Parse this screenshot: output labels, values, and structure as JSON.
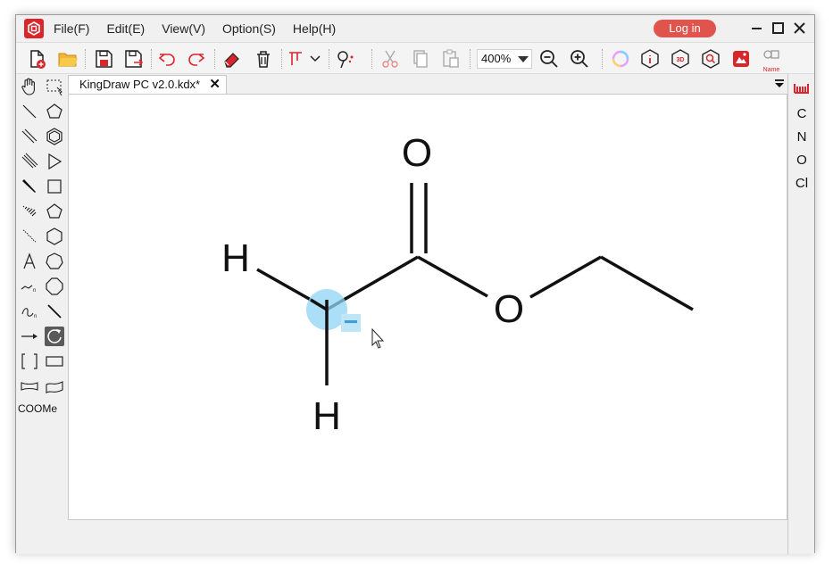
{
  "app": {
    "menu": [
      "File(F)",
      "Edit(E)",
      "View(V)",
      "Option(S)",
      "Help(H)"
    ],
    "login_label": "Log in",
    "brand_color": "#d9262c",
    "login_color": "#e0544e"
  },
  "toolbar": {
    "zoom_value": "400%",
    "name_label": "Name",
    "buttons": [
      "new-file-icon",
      "open-folder-icon",
      "save-icon",
      "save-as-icon",
      "undo-icon",
      "redo-icon",
      "eraser-icon",
      "delete-icon",
      "align-icon",
      "clean-structure-icon",
      "cut-icon",
      "copy-icon",
      "paste-icon",
      "zoom-out-icon",
      "zoom-in-icon",
      "color-ring-icon",
      "info-icon",
      "3d-view-icon",
      "search-structure-icon",
      "image-recognize-icon",
      "name-to-structure-icon"
    ]
  },
  "tabs": [
    {
      "label": "KingDraw PC v2.0.kdx*"
    }
  ],
  "left_tools": [
    "hand-tool",
    "lasso-select-tool",
    "single-bond-tool",
    "cyclopentane-tool",
    "double-bond-tool",
    "benzene-tool",
    "triple-bond-tool",
    "triangle-tool",
    "wedge-bond-tool",
    "square-tool",
    "hash-wedge-tool",
    "pentagon-tool",
    "wavy-bond-tool",
    "hexagon-tool",
    "text-tool",
    "heptagon-tool",
    "chain-tool",
    "octagon-tool",
    "curve-arrow-tool",
    "line-tool",
    "arrow-tool",
    "rotate-tool",
    "bracket-tool",
    "rectangle-tool",
    "ribbon-tool",
    "flag-tool"
  ],
  "left_tools_label": "COOMe",
  "right_elements": [
    "C",
    "N",
    "O",
    "Cl"
  ],
  "molecule": {
    "atoms": [
      "O",
      "H",
      "O",
      "H"
    ],
    "charge": "−",
    "highlight_color": "#8fd3f4"
  }
}
